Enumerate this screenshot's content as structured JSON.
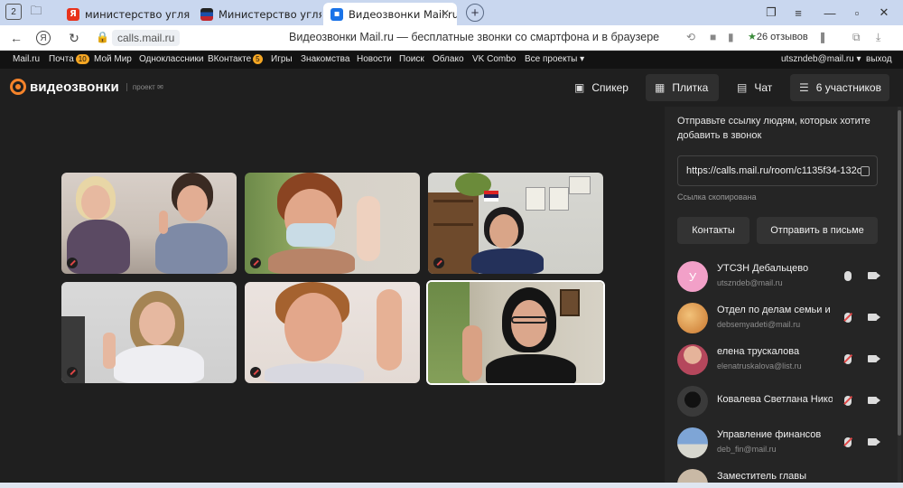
{
  "browser": {
    "tabs": [
      {
        "title": "министерство угля и энер",
        "favicon": "yandex",
        "color": "#e8321b"
      },
      {
        "title": "Министерство угля и энер",
        "favicon": "flag",
        "color": "#1c4fa8"
      },
      {
        "title": "Видеозвонки Mail.ru",
        "favicon": "mailru-calls",
        "color": "#1a73e8",
        "active": true
      }
    ],
    "url": "calls.mail.ru",
    "page_title": "Видеозвонки Mail.ru — бесплатные звонки со смартфона и в браузере",
    "reviews": "26 отзывов"
  },
  "portal_menu": {
    "items": [
      {
        "label": "Mail.ru"
      },
      {
        "label": "Почта",
        "badge": "10"
      },
      {
        "label": "Мой Мир"
      },
      {
        "label": "Одноклассники"
      },
      {
        "label": "ВКонтакте",
        "badge": "5"
      },
      {
        "label": "Игры"
      },
      {
        "label": "Знакомства"
      },
      {
        "label": "Новости"
      },
      {
        "label": "Поиск"
      },
      {
        "label": "Облако"
      },
      {
        "label": "VK Combo"
      },
      {
        "label": "Все проекты ▾"
      }
    ],
    "user": "utszndeb@mail.ru ▾",
    "logout": "выход"
  },
  "app": {
    "logo_text": "видеозвонки",
    "logo_sub": "проект ✉",
    "accent": "#f5832a",
    "buttons": {
      "speaker": "Спикер",
      "tile": "Плитка",
      "chat": "Чат",
      "participants": "6 участников"
    }
  },
  "sidebar": {
    "invite_text": "Отправьте ссылку людям, которых хотите добавить в звонок",
    "link": "https://calls.mail.ru/room/c1135f34-132c",
    "copied": "Ссылка скопирована",
    "contacts_btn": "Контакты",
    "send_btn": "Отправить в письме",
    "participants": [
      {
        "name": "УТСЗН Дебальцево",
        "email": "utszndeb@mail.ru",
        "initial": "У",
        "avatar_color": "#f2a0c8",
        "mic_off": false
      },
      {
        "name": "Отдел по делам семьи и детей",
        "email": "debsemyadeti@mail.ru",
        "initial": "",
        "avatar_color": "#d98a3a",
        "mic_off": true
      },
      {
        "name": "елена трускалова",
        "email": "elenatruskalova@list.ru",
        "initial": "",
        "avatar_color": "#b5475c",
        "mic_off": true
      },
      {
        "name": "Ковалева Светлана Николаевна",
        "email": "",
        "initial": "",
        "avatar_color": "#3a3a3a",
        "mic_off": true
      },
      {
        "name": "Управление финансов",
        "email": "deb_fin@mail.ru",
        "initial": "",
        "avatar_color": "#5a7fb0",
        "mic_off": true
      },
      {
        "name": "Заместитель главы",
        "email": "",
        "initial": "",
        "avatar_color": "#c9b9a5",
        "mic_off": true
      }
    ]
  }
}
